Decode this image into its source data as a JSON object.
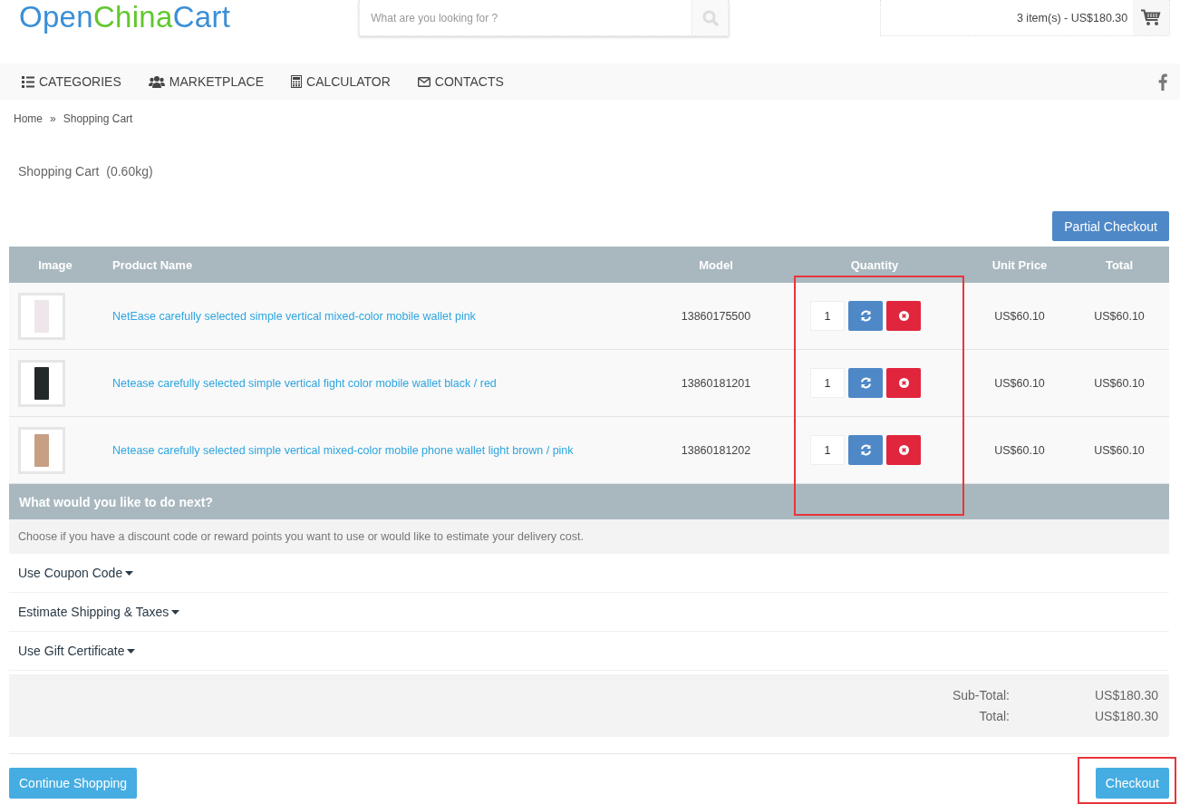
{
  "logo": [
    {
      "text": "Open",
      "color": "#3a8fd6"
    },
    {
      "text": "China",
      "color": "#62c72f"
    },
    {
      "text": "Cart",
      "color": "#3a8fd6"
    }
  ],
  "search": {
    "placeholder": "What are you looking for ?"
  },
  "cart_summary": "3 item(s) - US$180.30",
  "nav": [
    {
      "label": "CATEGORIES"
    },
    {
      "label": "MARKETPLACE"
    },
    {
      "label": "CALCULATOR"
    },
    {
      "label": "CONTACTS"
    }
  ],
  "breadcrumb": [
    "Home",
    "Shopping Cart"
  ],
  "breadcrumb_separator": "»",
  "heading": "Shopping Cart  (0.60kg)",
  "partial_checkout": "Partial Checkout",
  "table": {
    "columns": [
      {
        "label": "Image",
        "highlighted": false
      },
      {
        "label": "Product Name",
        "highlighted": false
      },
      {
        "label": "Model",
        "highlighted": false
      },
      {
        "label": "Quantity",
        "highlighted": true
      },
      {
        "label": "Unit Price",
        "highlighted": false
      },
      {
        "label": "Total",
        "highlighted": false
      }
    ],
    "rows": [
      {
        "name": "NetEase carefully selected simple vertical mixed-color mobile wallet pink",
        "model": "13860175500",
        "quantity": "1",
        "unit_price": "US$60.10",
        "total": "US$60.10"
      },
      {
        "name": "Netease carefully selected simple vertical fight color mobile wallet black / red",
        "model": "13860181201",
        "quantity": "1",
        "unit_price": "US$60.10",
        "total": "US$60.10"
      },
      {
        "name": "Netease carefully selected simple vertical mixed-color mobile phone wallet light brown / pink",
        "model": "13860181202",
        "quantity": "1",
        "unit_price": "US$60.10",
        "total": "US$60.10"
      }
    ]
  },
  "next": {
    "title": "What would you like to do next?",
    "description": "Choose if you have a discount code or reward points you want to use or would like to estimate your delivery cost.",
    "options": [
      {
        "label": "Use Coupon Code",
        "expanded": false
      },
      {
        "label": "Estimate Shipping & Taxes",
        "expanded": false
      },
      {
        "label": "Use Gift Certificate",
        "expanded": false
      }
    ]
  },
  "totals": [
    {
      "label": "Sub-Total:",
      "value": "US$180.30"
    },
    {
      "label": "Total:",
      "value": "US$180.30"
    }
  ],
  "continue_button": {
    "label": "Continue Shopping"
  },
  "checkout_button": {
    "label": "Checkout",
    "highlighted": true
  }
}
